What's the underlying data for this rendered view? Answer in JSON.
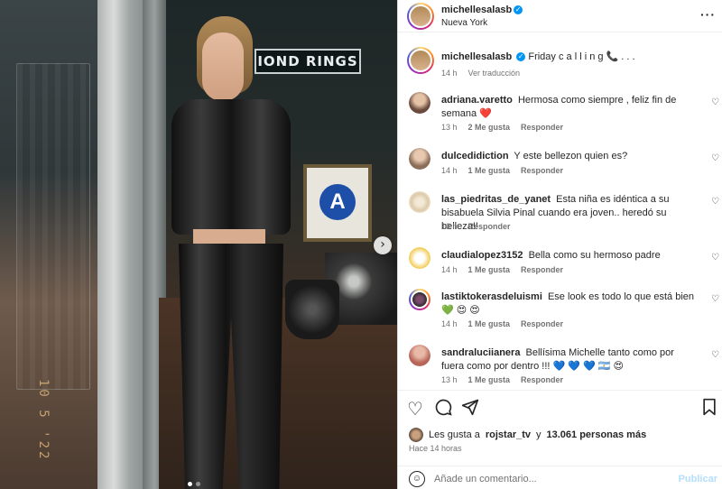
{
  "post": {
    "author": "michellesalasb",
    "location": "Nueva York",
    "caption": "Friday c a l l i n g 📞 . . .",
    "caption_time": "14 h",
    "translate_label": "Ver traducción",
    "sign_text": "IOND RINGS",
    "cert_letter": "A",
    "photo_stamp": "10 5 '22"
  },
  "comments": [
    {
      "user": "adriana.varetto",
      "text": "Hermosa como siempre , feliz fin de semana ❤️",
      "time": "13 h",
      "likes": "2 Me gusta",
      "reply": "Responder",
      "avatar_color": "#6b4b3e"
    },
    {
      "user": "dulcedidiction",
      "text": "Y este bellezon quien es?",
      "time": "14 h",
      "likes": "1 Me gusta",
      "reply": "Responder",
      "avatar_color": "#8c6d5a"
    },
    {
      "user": "las_piedritas_de_yanet",
      "text": "Esta niña es idéntica a su bisabuela Silvia Pinal cuando era joven.. heredó su belleza!!",
      "time": "13 h",
      "likes": "",
      "reply": "Responder",
      "avatar_color": "#d9c7a8"
    },
    {
      "user": "claudialopez3152",
      "text": "Bella como su hermoso padre",
      "time": "14 h",
      "likes": "1 Me gusta",
      "reply": "Responder",
      "avatar_color": "#f2c94c"
    },
    {
      "user": "lastiktokerasdeluismi",
      "text": "Ese look es todo lo que está bien 💚 😍 😍",
      "time": "14 h",
      "likes": "1 Me gusta",
      "reply": "Responder",
      "avatar_color": "#2b2b2b"
    },
    {
      "user": "sandraluciianera",
      "text": "Bellísima Michelle tanto como por fuera como por dentro !!! 💙 💙 💙 🇦🇷 😍",
      "time": "13 h",
      "likes": "1 Me gusta",
      "reply": "Responder",
      "avatar_color": "#b8665a"
    }
  ],
  "actions": {
    "like_icon": "heart-icon",
    "comment_icon": "comment-icon",
    "share_icon": "share-icon",
    "save_icon": "bookmark-icon"
  },
  "likes": {
    "prefix": "Les gusta a",
    "user": "rojstar_tv",
    "middle": "y",
    "count": "13.061 personas más"
  },
  "posted_ago": "Hace 14 horas",
  "composer": {
    "placeholder": "Añade un comentario...",
    "publish_label": "Publicar"
  },
  "colors": {
    "accent": "#0095f6",
    "publish_disabled": "#b2dffc",
    "muted": "#737373"
  }
}
